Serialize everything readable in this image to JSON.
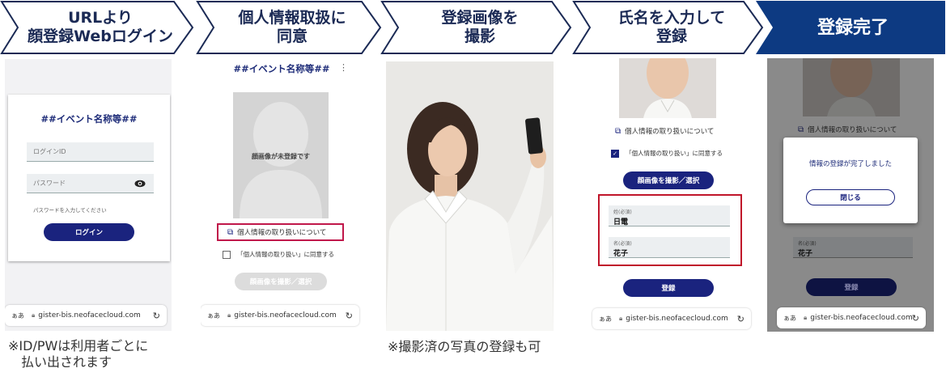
{
  "steps": [
    {
      "label": "URLより\n顔登録Webログイン"
    },
    {
      "label": "個人情報取扱に\n同意"
    },
    {
      "label": "登録画像を\n撮影"
    },
    {
      "label": "氏名を入力して\n登録"
    },
    {
      "label": "登録完了"
    }
  ],
  "colors": {
    "step_fill": "#ffffff",
    "step_border": "#1b2a55",
    "final_fill": "#0d3a82",
    "navy_button": "#1a237e",
    "highlight": "#c0174a"
  },
  "panel1": {
    "event_title": "##イベント名称等##",
    "login_id_placeholder": "ログインID",
    "password_placeholder": "パスワード",
    "password_hint": "パスワードを入力してください",
    "login_button": "ログイン",
    "eye_icon": "eye-icon"
  },
  "panel2": {
    "event_title": "##イベント名称等##",
    "no_photo_text": "顔画像が未登録です",
    "privacy_link": "個人情報の取り扱いについて",
    "agree_label": "「個人情報の取り扱い」に同意する",
    "capture_button": "顔画像を撮影／選択"
  },
  "panel4": {
    "privacy_link": "個人情報の取り扱いについて",
    "agree_label": "「個人情報の取り扱い」に同意する",
    "capture_button": "顔画像を撮影／選択",
    "last_name_label": "姓(必須)",
    "last_name_value": "日電",
    "first_name_label": "名(必須)",
    "first_name_value": "花子",
    "register_button": "登録"
  },
  "panel5": {
    "privacy_link": "個人情報の取り扱いについて",
    "dialog_message": "情報の登録が完了しました",
    "close_button": "閉じる",
    "first_name_label": "名(必須)",
    "first_name_value": "花子",
    "register_button": "登録"
  },
  "browser": {
    "aa": "ぁあ",
    "url": "gister-bis.neofacecloud.com"
  },
  "notes": {
    "idpw": "※ID/PWは利用者ごとに\n　払い出されます",
    "photo": "※撮影済の写真の登録も可"
  }
}
